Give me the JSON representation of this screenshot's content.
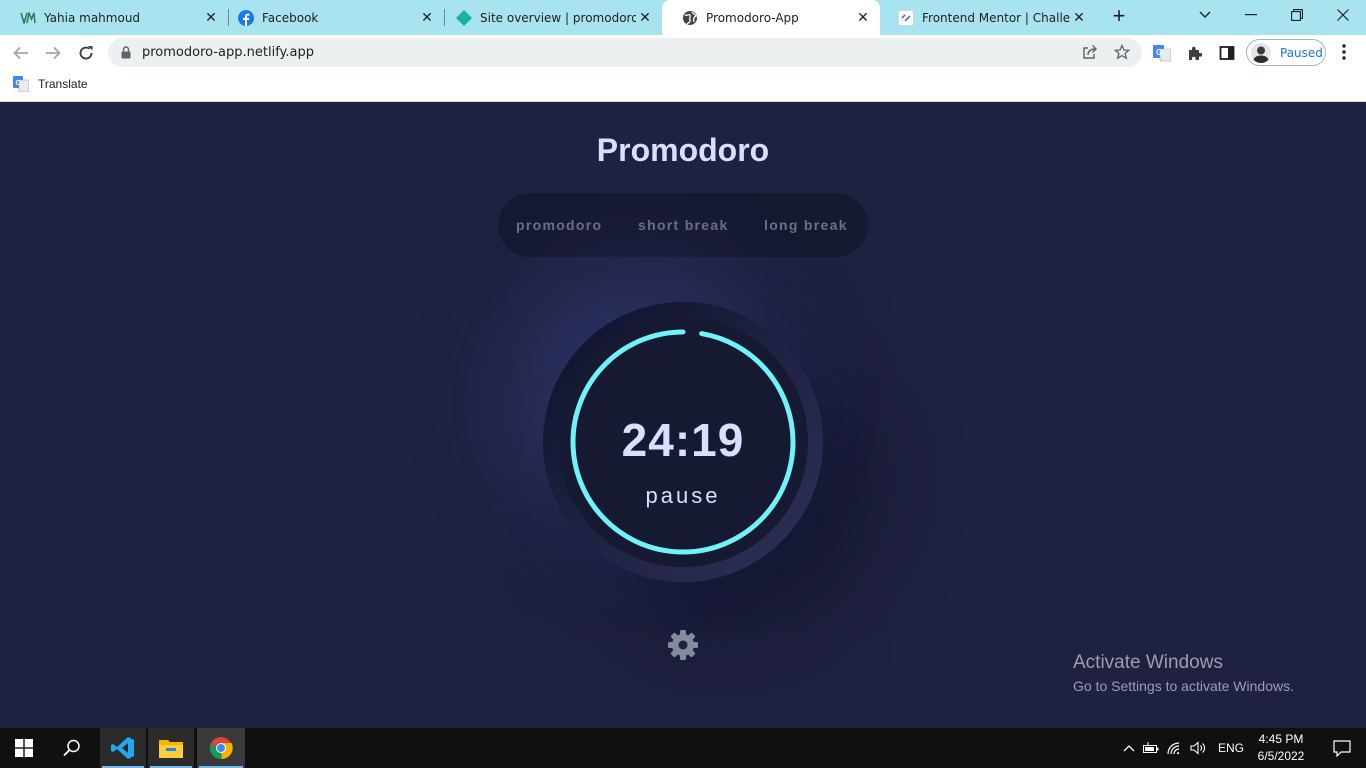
{
  "browser": {
    "tabs": [
      {
        "title": "Yahia mahmoud",
        "icon": "ym-logo-icon"
      },
      {
        "title": "Facebook",
        "icon": "facebook-icon"
      },
      {
        "title": "Site overview | promodoro-ap",
        "icon": "netlify-icon"
      },
      {
        "title": "Promodoro-App",
        "icon": "globe-icon",
        "active": true
      },
      {
        "title": "Frontend Mentor | Challenge",
        "icon": "frontend-mentor-icon"
      }
    ],
    "url": "promodoro-app.netlify.app",
    "profile_label": "Paused",
    "bookmarks": [
      {
        "label": "Translate",
        "icon": "google-translate-icon"
      }
    ],
    "accent_color": "#a8e4f0"
  },
  "app": {
    "title": "Promodoro",
    "modes": [
      "promodoro",
      "short break",
      "long break"
    ],
    "active_mode": null,
    "timer": {
      "time": "24:19",
      "state": "pause",
      "progress": 0.973
    },
    "ring_color": "#70f3f8",
    "background_color": "#1e213f",
    "settings_icon": "gear-icon"
  },
  "watermark": {
    "heading": "Activate Windows",
    "subtext": "Go to Settings to activate Windows."
  },
  "taskbar": {
    "apps": [
      "windows-start-icon",
      "search-icon",
      "vscode-icon",
      "file-explorer-icon",
      "chrome-icon"
    ],
    "language": "ENG",
    "time": "4:45 PM",
    "date": "6/5/2022"
  }
}
